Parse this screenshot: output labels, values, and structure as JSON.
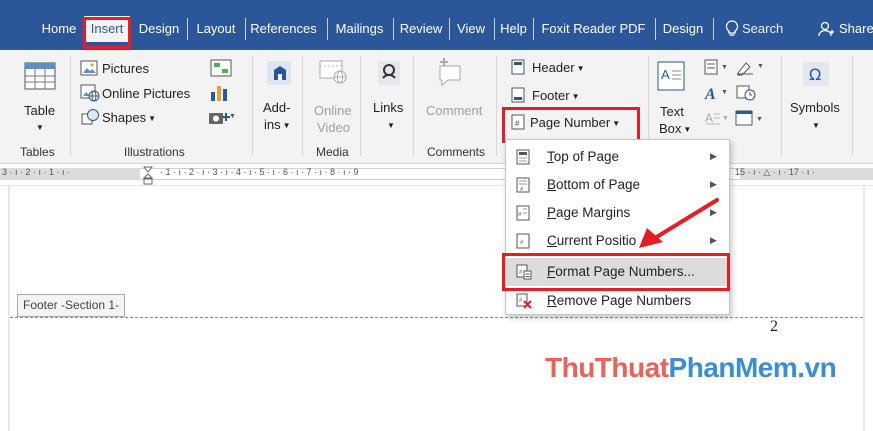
{
  "tabs": [
    {
      "id": "home",
      "label": "Home"
    },
    {
      "id": "insert",
      "label": "Insert"
    },
    {
      "id": "design",
      "label": "Design"
    },
    {
      "id": "layout",
      "label": "Layout"
    },
    {
      "id": "references",
      "label": "References"
    },
    {
      "id": "mailings",
      "label": "Mailings"
    },
    {
      "id": "review",
      "label": "Review"
    },
    {
      "id": "view",
      "label": "View"
    },
    {
      "id": "help",
      "label": "Help"
    },
    {
      "id": "foxit",
      "label": "Foxit Reader PDF"
    },
    {
      "id": "design2",
      "label": "Design"
    },
    {
      "id": "search",
      "label": "Search"
    },
    {
      "id": "share",
      "label": "Share"
    }
  ],
  "ribbon": {
    "tables": {
      "button": "Table",
      "group": "Tables"
    },
    "illustrations": {
      "pictures": "Pictures",
      "online_pictures": "Online Pictures",
      "shapes": "Shapes",
      "group": "Illustrations"
    },
    "addins": {
      "line1": "Add-",
      "line2": "ins"
    },
    "media": {
      "line1": "Online",
      "line2": "Video",
      "group": "Media"
    },
    "links": {
      "button": "Links"
    },
    "comments": {
      "button": "Comment",
      "group": "Comments"
    },
    "header_footer": {
      "header": "Header",
      "footer": "Footer",
      "page_number": "Page Number"
    },
    "text": {
      "line1": "Text",
      "line2": "Box"
    },
    "symbols": {
      "button": "Symbols"
    }
  },
  "ruler": {
    "left_ticks": "3 · ı · 2 · ı · 1 · ı ·",
    "mid_ticks": "· 1 · ı · 2 · ı · 3 · ı · 4 · ı · 5 · ı · 6 · ı · 7 · ı · 8 · ı · 9",
    "right_ticks": "15 · ı · △ · ı · 17 · ı ·"
  },
  "page_number_menu": {
    "items": [
      {
        "label": "Top of Page",
        "accel": "T",
        "rest": "op of Page",
        "submenu": true
      },
      {
        "label": "Bottom of Page",
        "accel": "B",
        "rest": "ottom of Page",
        "submenu": true
      },
      {
        "label": "Page Margins",
        "accel": "P",
        "rest": "age Margins",
        "submenu": true
      },
      {
        "label": "Current Position",
        "accel": "C",
        "rest": "urrent Positio",
        "submenu": true
      },
      {
        "label": "Format Page Numbers...",
        "accel": "F",
        "rest": "ormat Page Numbers...",
        "submenu": false
      },
      {
        "label": "Remove Page Numbers",
        "accel": "R",
        "rest": "emove Page Numbers",
        "submenu": false
      }
    ]
  },
  "document": {
    "footer_tag": "Footer -Section 1-",
    "page_number": "2"
  },
  "watermark": {
    "part1": "ThuThuat",
    "part2": "PhanMem",
    "part3": ".vn"
  },
  "colors": {
    "ribbon_blue": "#2b579a",
    "highlight_red": "#e31e24",
    "watermark_red": "#e8635a",
    "watermark_blue": "#3b8ed1"
  }
}
